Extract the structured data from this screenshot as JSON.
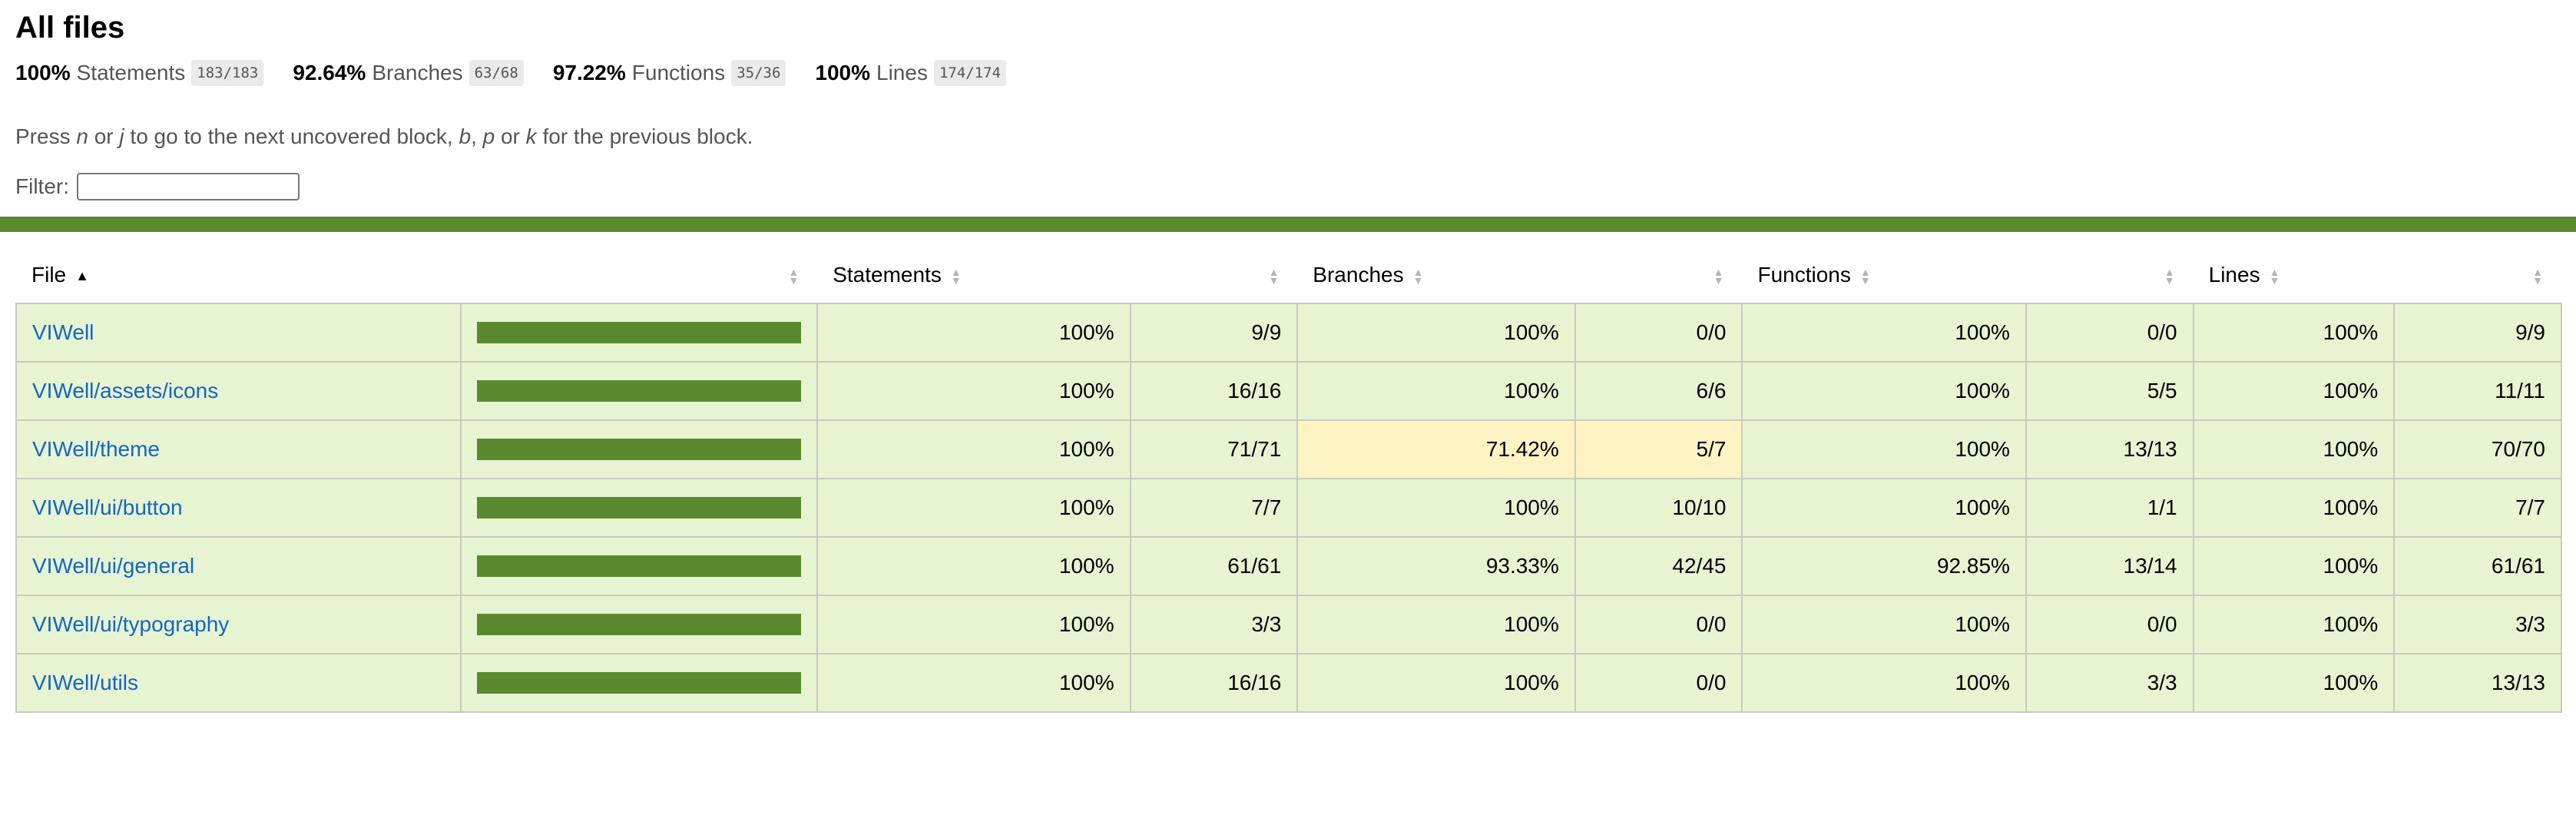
{
  "page": {
    "title": "All files",
    "hint_prefix": "Press",
    "hint_key1": "n",
    "hint_or1": "or",
    "hint_key2": "j",
    "hint_mid": "to go to the next uncovered block,",
    "hint_key3": "b",
    "hint_comma": ",",
    "hint_key4": "p",
    "hint_or2": "or",
    "hint_key5": "k",
    "hint_suffix": "for the previous block.",
    "filter_label": "Filter:",
    "filter_value": ""
  },
  "summary": [
    {
      "pct": "100%",
      "name": "Statements",
      "frac": "183/183"
    },
    {
      "pct": "92.64%",
      "name": "Branches",
      "frac": "63/68"
    },
    {
      "pct": "97.22%",
      "name": "Functions",
      "frac": "35/36"
    },
    {
      "pct": "100%",
      "name": "Lines",
      "frac": "174/174"
    }
  ],
  "headers": {
    "file": "File",
    "statements": "Statements",
    "branches": "Branches",
    "functions": "Functions",
    "lines": "Lines"
  },
  "colors": {
    "high_bg": "#e6f4d2",
    "medium_bg": "#fff3c4",
    "bar_fill": "#5b8a2e",
    "link": "#1565c0"
  },
  "rows": [
    {
      "file": "VIWell",
      "coverage": 1.0,
      "stmt_pct": "100%",
      "stmt_frac": "9/9",
      "branch_pct": "100%",
      "branch_frac": "0/0",
      "func_pct": "100%",
      "func_frac": "0/0",
      "line_pct": "100%",
      "line_frac": "9/9"
    },
    {
      "file": "VIWell/assets/icons",
      "coverage": 1.0,
      "stmt_pct": "100%",
      "stmt_frac": "16/16",
      "branch_pct": "100%",
      "branch_frac": "6/6",
      "func_pct": "100%",
      "func_frac": "5/5",
      "line_pct": "100%",
      "line_frac": "11/11"
    },
    {
      "file": "VIWell/theme",
      "coverage": 1.0,
      "stmt_pct": "100%",
      "stmt_frac": "71/71",
      "branch_pct": "71.42%",
      "branch_frac": "5/7",
      "branch_medium": true,
      "func_pct": "100%",
      "func_frac": "13/13",
      "line_pct": "100%",
      "line_frac": "70/70"
    },
    {
      "file": "VIWell/ui/button",
      "coverage": 1.0,
      "stmt_pct": "100%",
      "stmt_frac": "7/7",
      "branch_pct": "100%",
      "branch_frac": "10/10",
      "func_pct": "100%",
      "func_frac": "1/1",
      "line_pct": "100%",
      "line_frac": "7/7"
    },
    {
      "file": "VIWell/ui/general",
      "coverage": 1.0,
      "stmt_pct": "100%",
      "stmt_frac": "61/61",
      "branch_pct": "93.33%",
      "branch_frac": "42/45",
      "func_pct": "92.85%",
      "func_frac": "13/14",
      "line_pct": "100%",
      "line_frac": "61/61"
    },
    {
      "file": "VIWell/ui/typography",
      "coverage": 1.0,
      "stmt_pct": "100%",
      "stmt_frac": "3/3",
      "branch_pct": "100%",
      "branch_frac": "0/0",
      "func_pct": "100%",
      "func_frac": "0/0",
      "line_pct": "100%",
      "line_frac": "3/3"
    },
    {
      "file": "VIWell/utils",
      "coverage": 1.0,
      "stmt_pct": "100%",
      "stmt_frac": "16/16",
      "branch_pct": "100%",
      "branch_frac": "0/0",
      "func_pct": "100%",
      "func_frac": "3/3",
      "line_pct": "100%",
      "line_frac": "13/13"
    }
  ]
}
